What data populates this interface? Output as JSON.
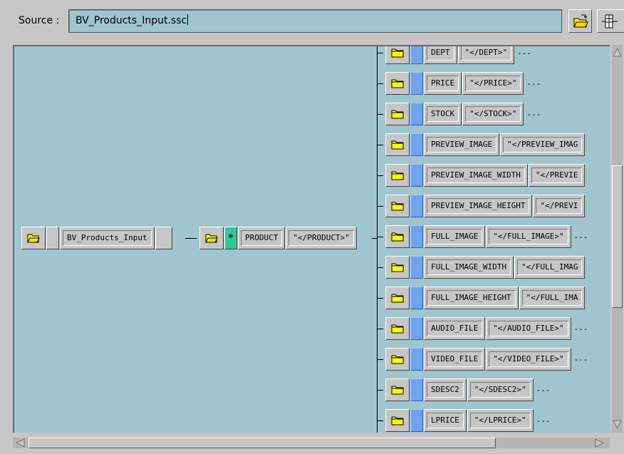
{
  "source": {
    "label": "Source :",
    "value": "BV_Products_Input.ssc"
  },
  "toolbar": {
    "open_icon": "open-folder-icon",
    "columns_icon": "columns-icon"
  },
  "tree": {
    "root": {
      "label": "BV_Products_Input"
    },
    "product": {
      "repeat_marker": "*",
      "label": "PRODUCT",
      "end_tag": "\"</PRODUCT>\""
    },
    "children": [
      {
        "label": "DEPT",
        "end_tag": "\"</DEPT>\"",
        "dashes": "---"
      },
      {
        "label": "PRICE",
        "end_tag": "\"</PRICE>\"",
        "dashes": "---"
      },
      {
        "label": "STOCK",
        "end_tag": "\"</STOCK>\"",
        "dashes": "---"
      },
      {
        "label": "PREVIEW_IMAGE",
        "end_tag": "\"</PREVIEW_IMAG",
        "dashes": ""
      },
      {
        "label": "PREVIEW_IMAGE_WIDTH",
        "end_tag": "\"</PREVIE",
        "dashes": ""
      },
      {
        "label": "PREVIEW_IMAGE_HEIGHT",
        "end_tag": "\"</PREVI",
        "dashes": ""
      },
      {
        "label": "FULL_IMAGE",
        "end_tag": "\"</FULL_IMAGE>\"",
        "dashes": "---"
      },
      {
        "label": "FULL_IMAGE_WIDTH",
        "end_tag": "\"</FULL_IMAG",
        "dashes": ""
      },
      {
        "label": "FULL_IMAGE_HEIGHT",
        "end_tag": "\"</FULL_IMA",
        "dashes": ""
      },
      {
        "label": "AUDIO_FILE",
        "end_tag": "\"</AUDIO_FILE>\"",
        "dashes": "---"
      },
      {
        "label": "VIDEO_FILE",
        "end_tag": "\"</VIDEO_FILE>\"",
        "dashes": "---"
      },
      {
        "label": "SDESC2",
        "end_tag": "\"</SDESC2>\"",
        "dashes": "---"
      },
      {
        "label": "LPRICE",
        "end_tag": "\"</LPRICE>\"",
        "dashes": "---"
      }
    ]
  },
  "scroll": {
    "vertical_position": 0.31,
    "horizontal_position": 0.0
  },
  "colors": {
    "canvas": "#9fc5cf",
    "folder": "#ffff00",
    "element_marker": "#6ea3f0",
    "repeat_marker": "#2fc99a"
  }
}
